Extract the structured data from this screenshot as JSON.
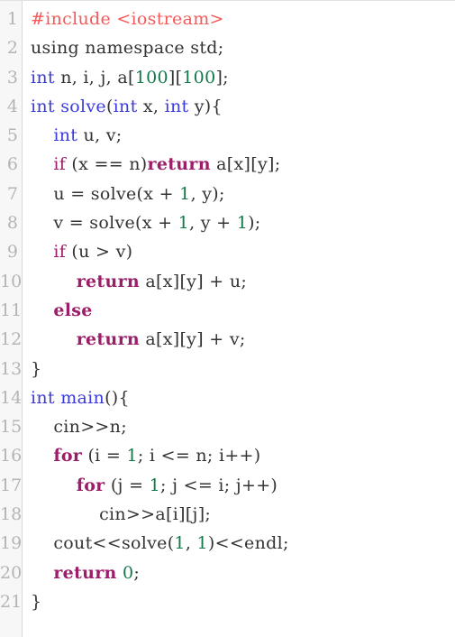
{
  "editor": {
    "name": "code-viewer",
    "language": "cpp",
    "total_lines": 21,
    "colors": {
      "background": "#ffffff",
      "gutter_background": "#f7f7f7",
      "gutter_border": "#dadada",
      "line_number": "#b4b4b4",
      "plain_text": "#333333",
      "preprocessor": "#f55959",
      "type_keyword": "#3b3bdd",
      "function_name": "#3b3bdd",
      "control_keyword": "#9c1d68",
      "number_literal": "#13784a"
    }
  },
  "lines": [
    {
      "number": "1",
      "tokens": [
        {
          "text": "#include <iostream>",
          "cls": "t-pre"
        }
      ]
    },
    {
      "number": "2",
      "tokens": [
        {
          "text": "using namespace std;",
          "cls": "t-plain"
        }
      ]
    },
    {
      "number": "3",
      "tokens": [
        {
          "text": "int",
          "cls": "t-type"
        },
        {
          "text": " n, i, j, a[",
          "cls": "t-plain"
        },
        {
          "text": "100",
          "cls": "t-num"
        },
        {
          "text": "][",
          "cls": "t-plain"
        },
        {
          "text": "100",
          "cls": "t-num"
        },
        {
          "text": "];",
          "cls": "t-plain"
        }
      ]
    },
    {
      "number": "4",
      "tokens": [
        {
          "text": "int",
          "cls": "t-type"
        },
        {
          "text": " ",
          "cls": "t-plain"
        },
        {
          "text": "solve",
          "cls": "t-fnname"
        },
        {
          "text": "(",
          "cls": "t-plain"
        },
        {
          "text": "int",
          "cls": "t-type"
        },
        {
          "text": " x, ",
          "cls": "t-plain"
        },
        {
          "text": "int",
          "cls": "t-type"
        },
        {
          "text": " y){",
          "cls": "t-plain"
        }
      ]
    },
    {
      "number": "5",
      "tokens": [
        {
          "text": "    ",
          "cls": "t-plain"
        },
        {
          "text": "int",
          "cls": "t-type"
        },
        {
          "text": " u, v;",
          "cls": "t-plain"
        }
      ]
    },
    {
      "number": "6",
      "tokens": [
        {
          "text": "    ",
          "cls": "t-plain"
        },
        {
          "text": "if",
          "cls": "t-kw"
        },
        {
          "text": " (x == n)",
          "cls": "t-plain"
        },
        {
          "text": "return",
          "cls": "t-kwb"
        },
        {
          "text": " a[x][y];",
          "cls": "t-plain"
        }
      ]
    },
    {
      "number": "7",
      "tokens": [
        {
          "text": "    u = solve(x + ",
          "cls": "t-plain"
        },
        {
          "text": "1",
          "cls": "t-num"
        },
        {
          "text": ", y);",
          "cls": "t-plain"
        }
      ]
    },
    {
      "number": "8",
      "tokens": [
        {
          "text": "    v = solve(x + ",
          "cls": "t-plain"
        },
        {
          "text": "1",
          "cls": "t-num"
        },
        {
          "text": ", y + ",
          "cls": "t-plain"
        },
        {
          "text": "1",
          "cls": "t-num"
        },
        {
          "text": ");",
          "cls": "t-plain"
        }
      ]
    },
    {
      "number": "9",
      "tokens": [
        {
          "text": "    ",
          "cls": "t-plain"
        },
        {
          "text": "if",
          "cls": "t-kw"
        },
        {
          "text": " (u > v)",
          "cls": "t-plain"
        }
      ]
    },
    {
      "number": "10",
      "tokens": [
        {
          "text": "        ",
          "cls": "t-plain"
        },
        {
          "text": "return",
          "cls": "t-kwb"
        },
        {
          "text": " a[x][y] + u;",
          "cls": "t-plain"
        }
      ]
    },
    {
      "number": "11",
      "tokens": [
        {
          "text": "    ",
          "cls": "t-plain"
        },
        {
          "text": "else",
          "cls": "t-kwb"
        }
      ]
    },
    {
      "number": "12",
      "tokens": [
        {
          "text": "        ",
          "cls": "t-plain"
        },
        {
          "text": "return",
          "cls": "t-kwb"
        },
        {
          "text": " a[x][y] + v;",
          "cls": "t-plain"
        }
      ]
    },
    {
      "number": "13",
      "tokens": [
        {
          "text": "}",
          "cls": "t-plain"
        }
      ]
    },
    {
      "number": "14",
      "tokens": [
        {
          "text": "int",
          "cls": "t-type"
        },
        {
          "text": " ",
          "cls": "t-plain"
        },
        {
          "text": "main",
          "cls": "t-fnname"
        },
        {
          "text": "(){",
          "cls": "t-plain"
        }
      ]
    },
    {
      "number": "15",
      "tokens": [
        {
          "text": "    cin>>n;",
          "cls": "t-plain"
        }
      ]
    },
    {
      "number": "16",
      "tokens": [
        {
          "text": "    ",
          "cls": "t-plain"
        },
        {
          "text": "for",
          "cls": "t-kwb"
        },
        {
          "text": " (i = ",
          "cls": "t-plain"
        },
        {
          "text": "1",
          "cls": "t-num"
        },
        {
          "text": "; i <= n; i++)",
          "cls": "t-plain"
        }
      ]
    },
    {
      "number": "17",
      "tokens": [
        {
          "text": "        ",
          "cls": "t-plain"
        },
        {
          "text": "for",
          "cls": "t-kwb"
        },
        {
          "text": " (j = ",
          "cls": "t-plain"
        },
        {
          "text": "1",
          "cls": "t-num"
        },
        {
          "text": "; j <= i; j++)",
          "cls": "t-plain"
        }
      ]
    },
    {
      "number": "18",
      "tokens": [
        {
          "text": "            cin>>a[i][j];",
          "cls": "t-plain"
        }
      ]
    },
    {
      "number": "19",
      "tokens": [
        {
          "text": "    cout<<solve(",
          "cls": "t-plain"
        },
        {
          "text": "1",
          "cls": "t-num"
        },
        {
          "text": ", ",
          "cls": "t-plain"
        },
        {
          "text": "1",
          "cls": "t-num"
        },
        {
          "text": ")<<endl;",
          "cls": "t-plain"
        }
      ]
    },
    {
      "number": "20",
      "tokens": [
        {
          "text": "    ",
          "cls": "t-plain"
        },
        {
          "text": "return",
          "cls": "t-kwb"
        },
        {
          "text": " ",
          "cls": "t-plain"
        },
        {
          "text": "0",
          "cls": "t-num"
        },
        {
          "text": ";",
          "cls": "t-plain"
        }
      ]
    },
    {
      "number": "21",
      "tokens": [
        {
          "text": "}",
          "cls": "t-plain"
        }
      ]
    }
  ]
}
